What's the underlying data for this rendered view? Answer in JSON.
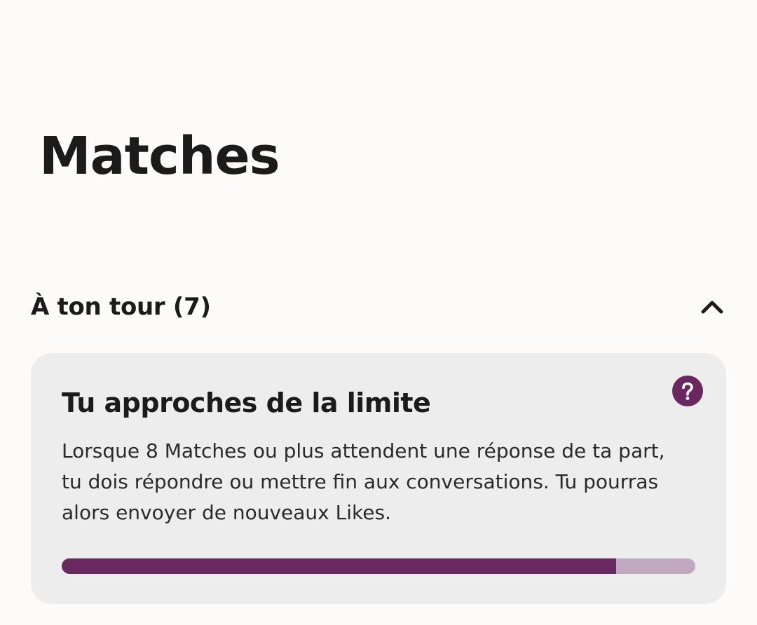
{
  "header": {
    "title": "Matches"
  },
  "section": {
    "title": "À ton tour (7)",
    "expanded": true
  },
  "limit_card": {
    "title": "Tu approches de la limite",
    "body": "Lorsque 8 Matches ou plus attendent une réponse de ta part, tu dois répondre ou mettre fin aux conversations. Tu pourras alors envoyer de nouveaux Likes.",
    "help_icon": "question-mark-icon",
    "progress_fraction": 0.875
  },
  "colors": {
    "accent": "#69285f",
    "progress_track": "#bfa8c0",
    "card_background": "#eeedee",
    "page_background": "#fcfbf9",
    "text": "#1b1b1b"
  }
}
